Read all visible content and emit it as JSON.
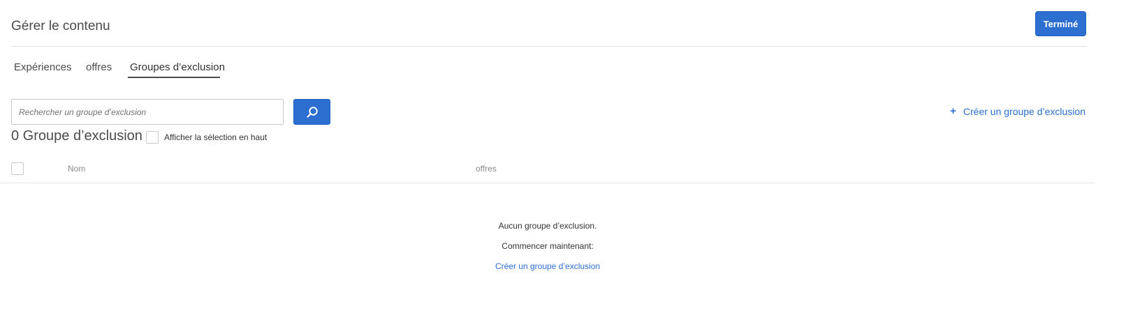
{
  "header": {
    "title": "Gérer le contenu",
    "done_label": "Terminé"
  },
  "tabs": [
    {
      "label": "Expériences",
      "active": false
    },
    {
      "label": "offres",
      "active": false
    },
    {
      "label": "Groupes d’exclusion",
      "active": true
    }
  ],
  "search": {
    "placeholder": "Rechercher un groupe d’exclusion",
    "value": "",
    "button_icon": "search-icon"
  },
  "create_action": {
    "icon": "+",
    "label": "Créer un groupe d’exclusion"
  },
  "list": {
    "count_title": "0 Groupe d’exclusion",
    "show_selected_label": "Afficher la sélection en haut",
    "show_selected_checked": false,
    "columns": [
      "Nom",
      "offres"
    ]
  },
  "empty_state": {
    "message": "Aucun groupe d’exclusion.",
    "prompt": "Commencer maintenant:",
    "link": "Créer un groupe d’exclusion"
  },
  "colors": {
    "accent": "#2d6fd1",
    "divider": "#e4e4e4"
  }
}
